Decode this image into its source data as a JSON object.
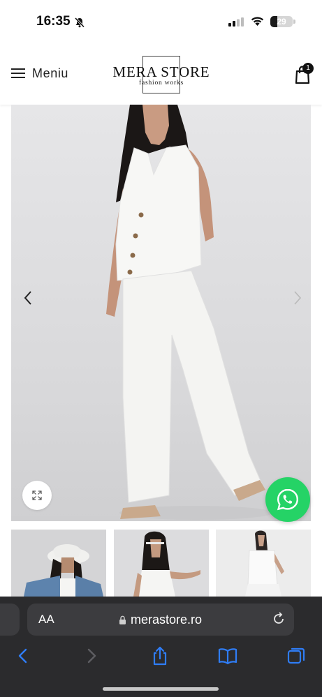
{
  "status": {
    "time": "16:35",
    "battery": "29",
    "battery_level": 0.29
  },
  "header": {
    "menu_label": "Meniu",
    "logo_title": "MERA STORE",
    "logo_subtitle": "fashion works",
    "cart_count": "1"
  },
  "gallery": {
    "prev_icon": "chevron-left-icon",
    "next_icon": "chevron-right-icon",
    "zoom_icon": "expand-icon"
  },
  "whatsapp_icon": "whatsapp-icon",
  "thumbnails": [
    "thumbnail-1",
    "thumbnail-2",
    "thumbnail-3"
  ],
  "browser": {
    "text_size_label": "AA",
    "url": "merastore.ro",
    "toolbar": [
      "back",
      "forward",
      "share",
      "bookmarks",
      "tabs"
    ]
  },
  "colors": {
    "accent": "#2f7df6",
    "whatsapp": "#25d366",
    "safari_bg": "#2b2b2d"
  }
}
